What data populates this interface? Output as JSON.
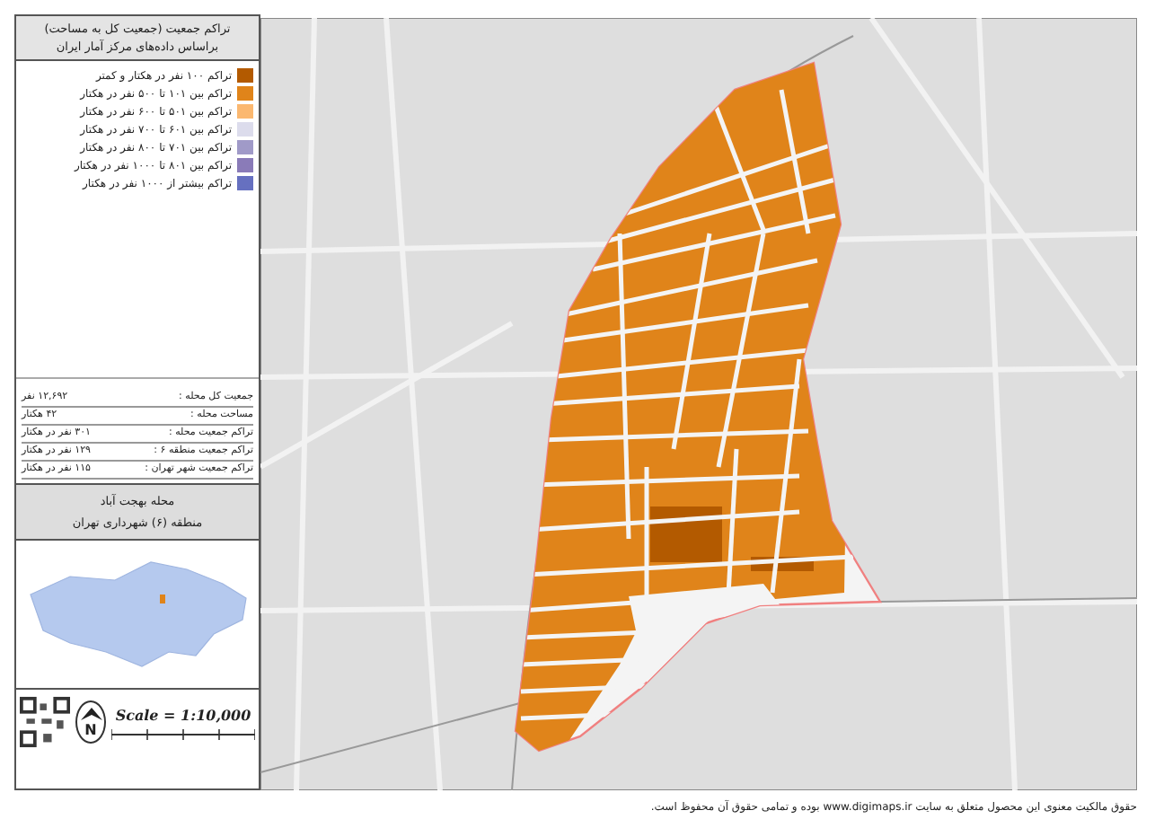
{
  "legend": {
    "title": "تراکم جمعیت (جمعیت کل به مساحت)",
    "subtitle": "براساس داده‌های مرکز آمار ایران",
    "items": [
      {
        "label": "تراکم ۱۰۰ نفر در هکتار و کمتر",
        "color": "#b35a00"
      },
      {
        "label": "تراکم بین ۱۰۱ تا ۵۰۰ نفر در هکتار",
        "color": "#e0841a"
      },
      {
        "label": "تراکم بین ۵۰۱ تا ۶۰۰ نفر در هکتار",
        "color": "#fbb870"
      },
      {
        "label": "تراکم بین ۶۰۱ تا ۷۰۰ نفر در هکتار",
        "color": "#dcdcec"
      },
      {
        "label": "تراکم بین ۷۰۱ تا ۸۰۰ نفر در هکتار",
        "color": "#a09ac8"
      },
      {
        "label": "تراکم بین ۸۰۱ تا ۱۰۰۰ نفر در هکتار",
        "color": "#8a7bb8"
      },
      {
        "label": "تراکم بیشتر از ۱۰۰۰ نفر در هکتار",
        "color": "#6670c0"
      }
    ]
  },
  "stats": [
    {
      "label": "جمعیت کل محله :",
      "value": "۱۲,۶۹۲ نفر"
    },
    {
      "label": "مساحت محله :",
      "value": "۴۲ هکتار"
    },
    {
      "label": "تراکم جمعیت محله :",
      "value": "۳۰۱ نفر در هکتار"
    },
    {
      "label": "تراکم جمعیت منطقه ۶ :",
      "value": "۱۲۹ نفر در هکتار"
    },
    {
      "label": "تراکم جمعیت شهر تهران :",
      "value": "۱۱۵ نفر در هکتار"
    }
  ],
  "location": {
    "neighborhood": "محله بهجت آباد",
    "district": "منطقه (۶) شهرداری تهران"
  },
  "north": {
    "label": "N"
  },
  "scale": {
    "text": "Scale = 1:10,000"
  },
  "copyright": "حقوق مالکیت معنوی این محصول متعلق به سایت www.digimaps.ir بوده و تمامی حقوق آن محفوظ است."
}
